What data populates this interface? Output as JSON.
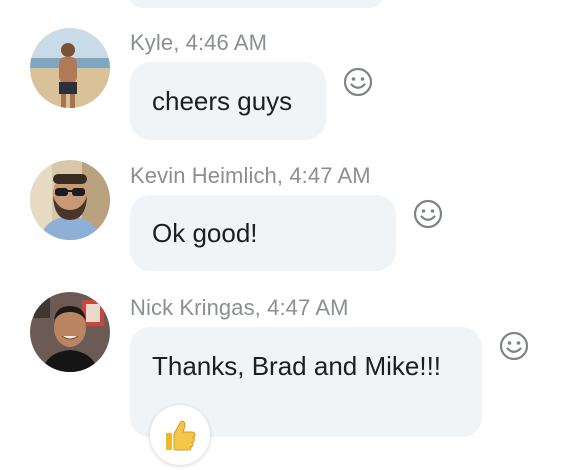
{
  "messages": [
    {
      "author": "Kyle",
      "time": "4:46 AM",
      "meta": "Kyle, 4:46 AM",
      "text": "cheers guys"
    },
    {
      "author": "Kevin Heimlich",
      "time": "4:47 AM",
      "meta": "Kevin Heimlich, 4:47 AM",
      "text": "Ok good!"
    },
    {
      "author": "Nick Kringas",
      "time": "4:47 AM",
      "meta": "Nick Kringas, 4:47 AM",
      "text": "Thanks, Brad and Mike!!!",
      "reaction": {
        "emoji": "👍",
        "icon": "thumbs-up-icon"
      }
    }
  ],
  "icons": {
    "add_reaction": "smiley-face-icon"
  },
  "colors": {
    "bubble_bg": "#f1f4f7",
    "meta_text": "#8b8f94",
    "message_text": "#1c1e21",
    "icon_stroke": "#7f8489"
  }
}
